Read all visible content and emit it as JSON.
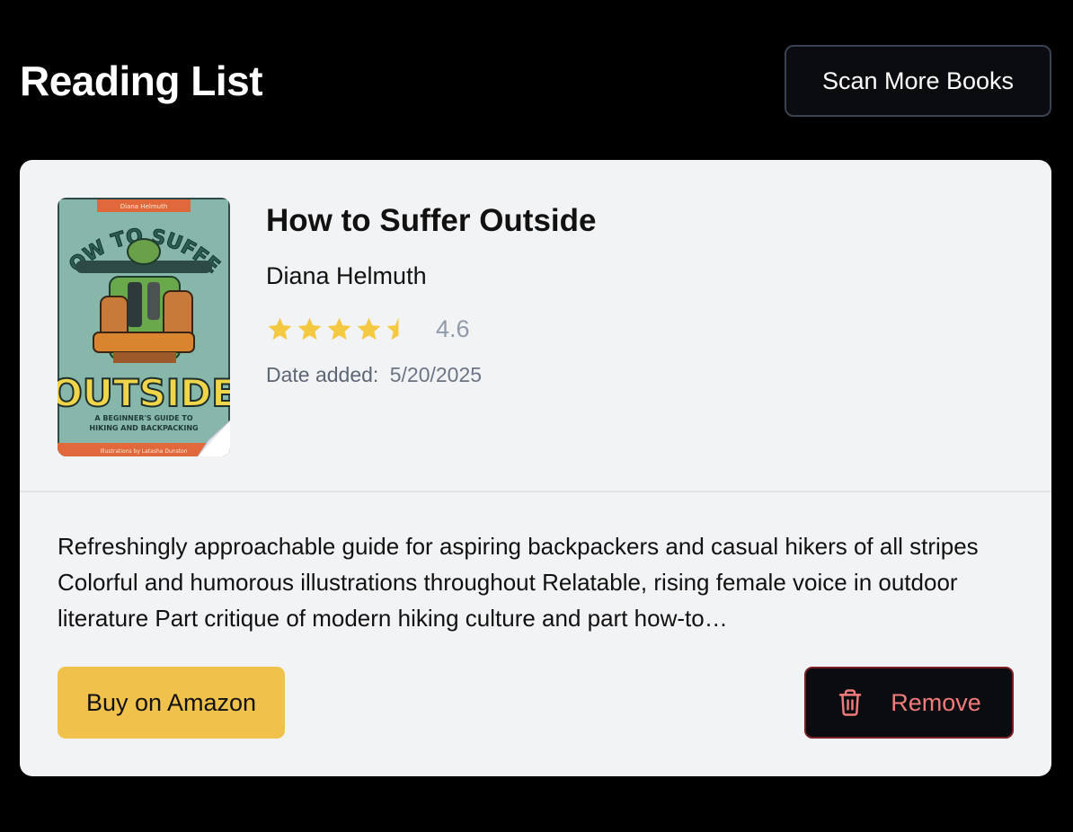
{
  "header": {
    "title": "Reading List",
    "scan_button_label": "Scan More Books"
  },
  "book": {
    "title": "How to Suffer Outside",
    "author": "Diana Helmuth",
    "rating": 4.6,
    "rating_text": "4.6",
    "star_color": "#f5c842",
    "date_label": "Date added:",
    "date_value": "5/20/2025",
    "description": "Refreshingly approachable guide for aspiring backpackers and casual hikers of all stripes Colorful and humorous illustrations throughout Relatable, rising female voice in outdoor literature Part critique of modern hiking culture and part how-to…",
    "cover": {
      "top_banner": "Diana Helmuth",
      "line1": "HOW TO SUFFER",
      "line2": "OUTSIDE",
      "subtitle1": "A BEGINNER'S GUIDE TO",
      "subtitle2": "HIKING AND BACKPACKING",
      "bottom_banner": "Illustrations by Latasha Dunston"
    }
  },
  "actions": {
    "buy_label": "Buy on Amazon",
    "remove_label": "Remove",
    "remove_icon": "trash-icon"
  },
  "colors": {
    "buy_button": "#f1c24b",
    "remove_text": "#f07b7b",
    "card_background": "#f2f3f5"
  }
}
